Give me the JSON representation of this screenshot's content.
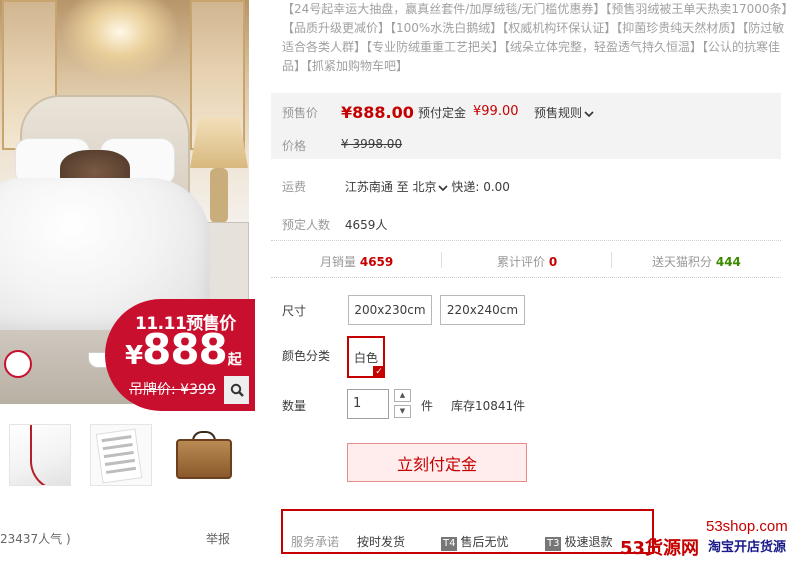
{
  "gallery": {
    "promo_title": "11.11预售价",
    "promo_currency": "¥",
    "promo_price": "888",
    "promo_suffix": "起",
    "promo_original": "吊牌价: ¥399",
    "popularity": "23437人气 )",
    "report": "举报"
  },
  "promo_text": "【24号起幸运大抽盘，赢真丝套件/加厚绒毯/无门槛优惠券】【预售羽绒被王单天热卖17000条】【品质升级更减价】【100%水洗白鹅绒】【权威机构环保认证】【抑菌珍贵纯天然材质】【防过敏适合各类人群】【专业防绒重重工艺把关】【绒朵立体完整，轻盈透气持久恒温】【公认的抗寒佳品】【抓紧加购物车吧】",
  "pricing": {
    "presale_label": "预售价",
    "presale_price": "¥888.00",
    "deposit_label": "预付定金",
    "deposit_value": "¥99.00",
    "rules_label": "预售规则",
    "price_label": "价格",
    "original_price": "¥ 3998.00"
  },
  "shipping": {
    "label": "运费",
    "from": "江苏南通",
    "to_word": "至",
    "destination": "北京",
    "express": "快递: 0.00"
  },
  "reserved": {
    "label": "预定人数",
    "value": "4659人"
  },
  "stats": {
    "sales_label": "月销量",
    "sales_value": "4659",
    "reviews_label": "累计评价",
    "reviews_value": "0",
    "points_label": "送天猫积分",
    "points_value": "444"
  },
  "sku": {
    "size_label": "尺寸",
    "sizes": [
      "200x230cm",
      "220x240cm"
    ],
    "color_label": "颜色分类",
    "color_selected": "白色",
    "qty_label": "数量",
    "qty_value": "1",
    "qty_unit": "件",
    "stock": "库存10841件"
  },
  "buy_button": "立刻付定金",
  "service": {
    "label": "服务承诺",
    "items": [
      "按时发货",
      "售后无忧",
      "极速退款"
    ],
    "tags": [
      "T4",
      "T3"
    ]
  },
  "watermark": {
    "site": "53shop.com",
    "logo": "53货源网",
    "slogan": "淘宝开店货源"
  }
}
